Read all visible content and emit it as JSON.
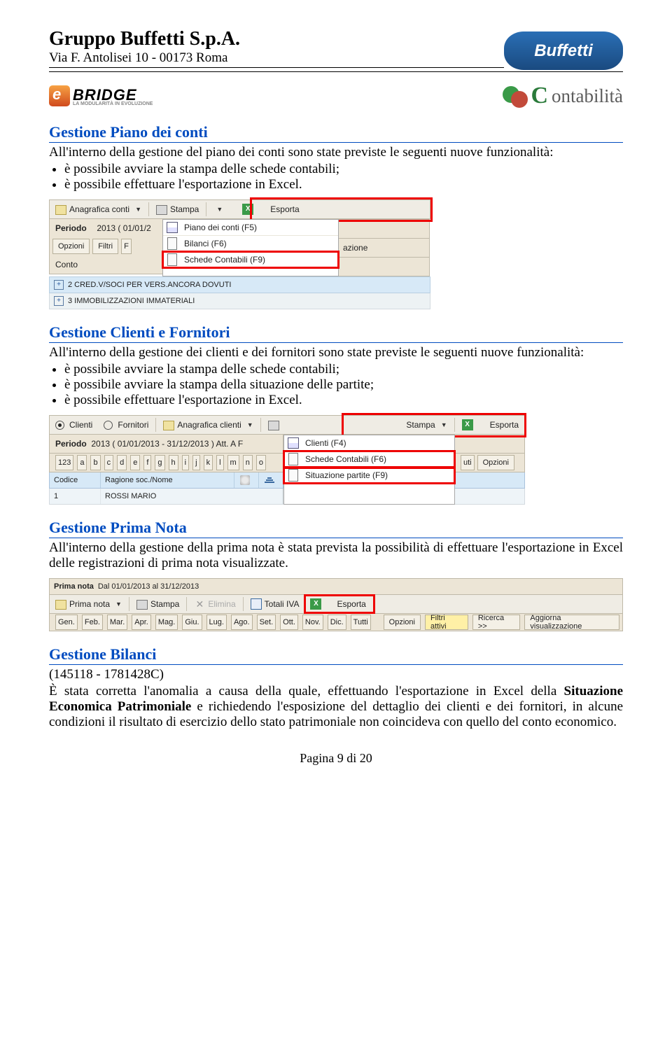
{
  "header": {
    "company": "Gruppo Buffetti S.p.A.",
    "address": "Via F. Antolisei 10 - 00173 Roma",
    "logo_text": "Buffetti",
    "ebridge_brand": "BRIDGE",
    "ebridge_tagline": "LA MODULARITÀ IN EVOLUZIONE",
    "contabilita_label": "ontabilità"
  },
  "sec1": {
    "title": "Gestione Piano dei conti",
    "intro": "All'interno della gestione del piano dei conti sono state previste le seguenti nuove funzionalità:",
    "bullets": [
      "è possibile avviare la stampa delle schede contabili;",
      "è possibile effettuare l'esportazione in Excel."
    ]
  },
  "frame1": {
    "anagrafica": "Anagrafica conti",
    "stampa": "Stampa",
    "esporta": "Esporta",
    "periodo_label": "Periodo",
    "periodo_value": "2013 ( 01/01/2",
    "opzioni": "Opzioni",
    "filtri": "Filtri",
    "f": "F",
    "azione_tail": "azione",
    "conto": "Conto",
    "menu": {
      "piano": "Piano dei conti (F5)",
      "bilanci": "Bilanci (F6)",
      "schede": "Schede Contabili (F9)"
    },
    "row1": "2 CRED.V/SOCI PER VERS.ANCORA DOVUTI",
    "row2": "3 IMMOBILIZZAZIONI IMMATERIALI"
  },
  "sec2": {
    "title": "Gestione Clienti e Fornitori",
    "intro": "All'interno della gestione dei clienti e dei fornitori sono state previste le seguenti nuove funzionalità:",
    "bullets": [
      "è possibile avviare la stampa delle schede contabili;",
      "è possibile avviare la stampa della situazione delle partite;",
      "è possibile effettuare l'esportazione in Excel."
    ]
  },
  "frame2": {
    "clienti": "Clienti",
    "fornitori": "Fornitori",
    "anagrafica": "Anagrafica clienti",
    "stampa": "Stampa",
    "esporta": "Esporta",
    "periodo_label": "Periodo",
    "periodo_value": "2013 ( 01/01/2013 - 31/12/2013 )  Att. A F",
    "letters": [
      "123",
      "a",
      "b",
      "c",
      "d",
      "e",
      "f",
      "g",
      "h",
      "i",
      "j",
      "k",
      "l",
      "m",
      "n",
      "o"
    ],
    "uti": "uti",
    "opzioni": "Opzioni",
    "menu": {
      "clienti": "Clienti (F4)",
      "schede": "Schede Contabili (F6)",
      "partite": "Situazione partite (F9)"
    },
    "th_codice": "Codice",
    "th_ragione": "Ragione soc./Nome",
    "row_code": "1",
    "row_name": "ROSSI MARIO"
  },
  "sec3": {
    "title": "Gestione Prima Nota",
    "body": "All'interno della gestione della prima nota è stata prevista la possibilità di effettuare l'esportazione in Excel delle registrazioni di prima nota visualizzate."
  },
  "frame3": {
    "title_label": "Prima nota",
    "title_period": "Dal 01/01/2013 al 31/12/2013",
    "prima_nota": "Prima nota",
    "stampa": "Stampa",
    "elimina": "Elimina",
    "totali": "Totali IVA",
    "esporta": "Esporta",
    "months": [
      "Gen.",
      "Feb.",
      "Mar.",
      "Apr.",
      "Mag.",
      "Giu.",
      "Lug.",
      "Ago.",
      "Set.",
      "Ott.",
      "Nov.",
      "Dic.",
      "Tutti"
    ],
    "opzioni": "Opzioni",
    "filtri_attivi": "Filtri attivi",
    "ricerca": "Ricerca >>",
    "aggiorna": "Aggiorna visualizzazione"
  },
  "sec4": {
    "title": "Gestione Bilanci",
    "code": "(145118 - 1781428C)",
    "body_1": "È stata corretta l'anomalia a causa della quale, effettuando l'esportazione in Excel della ",
    "body_bold": "Situazione Economica Patrimoniale",
    "body_2": " e richiedendo l'esposizione del dettaglio dei clienti e dei fornitori, in alcune condizioni il risultato di esercizio dello stato patrimoniale non coincideva con quello del conto economico."
  },
  "footer": {
    "page": "Pagina 9 di 20"
  }
}
